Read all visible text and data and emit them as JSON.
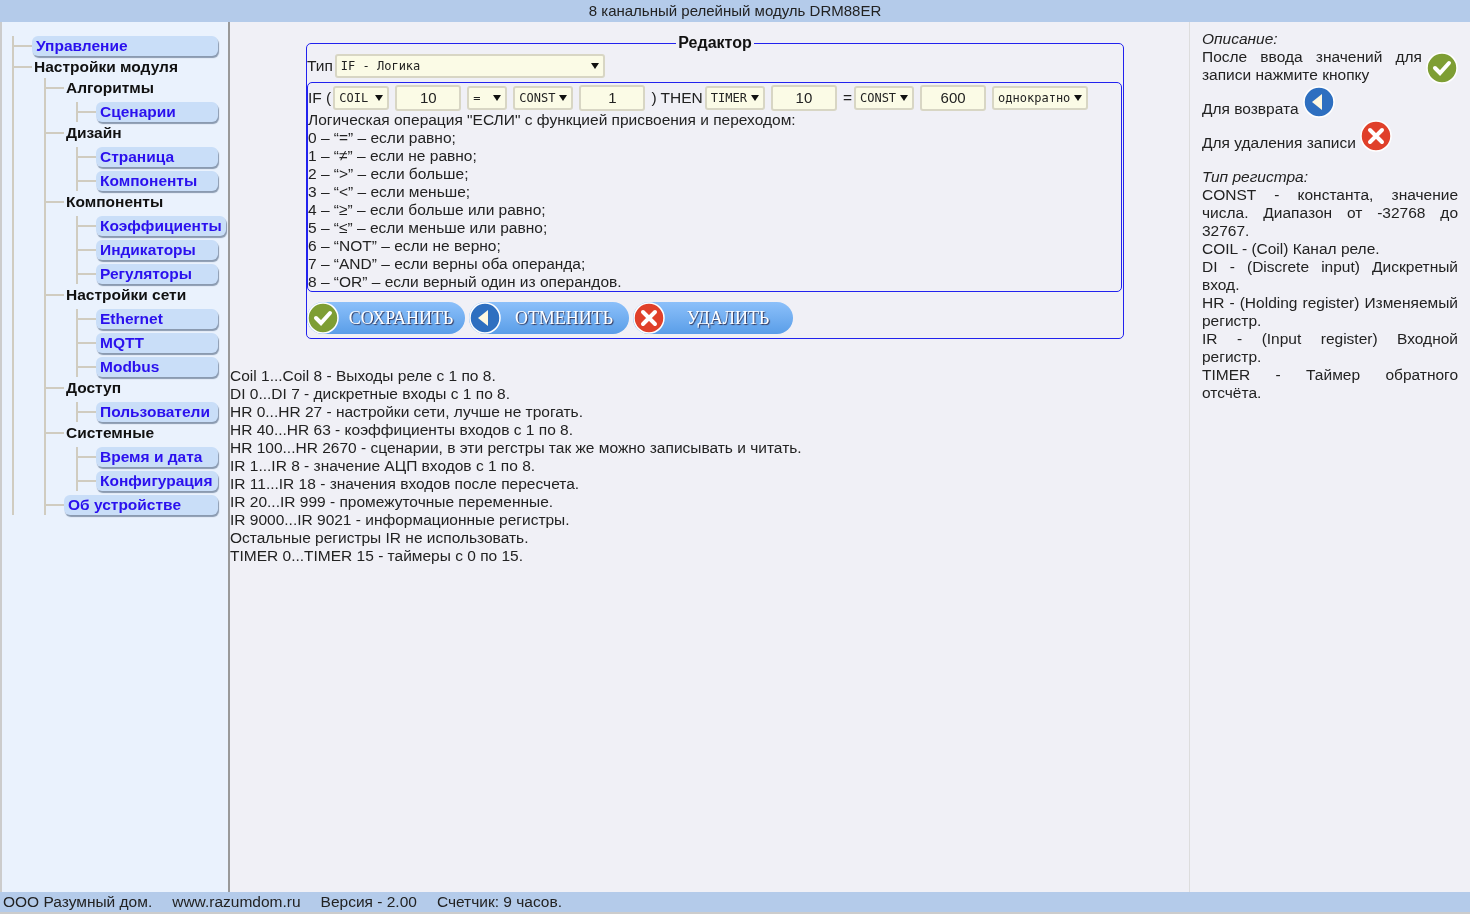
{
  "window": {
    "title": "8 канальный релейный модуль DRM88ER"
  },
  "sidebar": {
    "items": [
      {
        "label": "Управление",
        "kind": "link"
      },
      {
        "label": "Настройки модуля",
        "kind": "heading",
        "children": [
          {
            "label": "Алгоритмы",
            "kind": "heading",
            "children": [
              {
                "label": "Сценарии",
                "kind": "link"
              }
            ]
          },
          {
            "label": "Дизайн",
            "kind": "heading",
            "children": [
              {
                "label": "Страница",
                "kind": "link"
              },
              {
                "label": "Компоненты",
                "kind": "link"
              }
            ]
          },
          {
            "label": "Компоненты",
            "kind": "heading",
            "children": [
              {
                "label": "Коэффициенты",
                "kind": "link"
              },
              {
                "label": "Индикаторы",
                "kind": "link"
              },
              {
                "label": "Регуляторы",
                "kind": "link"
              }
            ]
          },
          {
            "label": "Настройки сети",
            "kind": "heading",
            "children": [
              {
                "label": "Ethernet",
                "kind": "link"
              },
              {
                "label": "MQTT",
                "kind": "link"
              },
              {
                "label": "Modbus",
                "kind": "link"
              }
            ]
          },
          {
            "label": "Доступ",
            "kind": "heading",
            "children": [
              {
                "label": "Пользователи",
                "kind": "link"
              }
            ]
          },
          {
            "label": "Системные",
            "kind": "heading",
            "children": [
              {
                "label": "Время и дата",
                "kind": "link"
              },
              {
                "label": "Конфигурация",
                "kind": "link"
              }
            ]
          },
          {
            "label": "Об устройстве",
            "kind": "link"
          }
        ]
      }
    ]
  },
  "editor": {
    "legend": "Редактор",
    "type_label": "Тип",
    "type_value": "IF  -  Логика",
    "condition": [
      {
        "kind": "text",
        "text": "IF ("
      },
      {
        "kind": "select",
        "value": "COIL"
      },
      {
        "kind": "input",
        "value": "10"
      },
      {
        "kind": "select",
        "value": "="
      },
      {
        "kind": "select",
        "value": "CONST"
      },
      {
        "kind": "input",
        "value": "1"
      },
      {
        "kind": "text",
        "text": ") THEN"
      },
      {
        "kind": "select",
        "value": "TIMER"
      },
      {
        "kind": "input",
        "value": "10"
      },
      {
        "kind": "text",
        "text": "="
      },
      {
        "kind": "select",
        "value": "CONST"
      },
      {
        "kind": "input",
        "value": "600"
      },
      {
        "kind": "select",
        "value": "однократно"
      }
    ],
    "help_lines": [
      "Логическая операция \"ЕСЛИ\" с функцией присвоения и переходом:",
      "0 – “=” – если равно;",
      "1 – “≠” – если не равно;",
      "2 – “>” – если больше;",
      "3 – “<” – если меньше;",
      "4 – “≥” – если больше или равно;",
      "5 – “≤” – если меньше или равно;",
      "6 – “NOT” – если не верно;",
      "7 – “AND” – если верны оба операнда;",
      "8 – “OR” – если верный один из операндов."
    ],
    "buttons": [
      {
        "label": "СОХРАНИТЬ",
        "kind": "save"
      },
      {
        "label": "ОТМЕНИТЬ",
        "kind": "back"
      },
      {
        "label": "УДАЛИТЬ",
        "kind": "delete"
      }
    ]
  },
  "register_notes": [
    "Coil 1...Coil 8 - Выходы реле с 1 по 8.",
    "DI 0...DI 7 - дискретные входы с 1 по 8.",
    "HR 0...HR 27 - настройки сети, лучше не трогать.",
    "HR 40...HR 63 - коэффициенты входов с 1 по 8.",
    "HR 100...HR 2670 - сценарии, в эти регстры так же можно записывать и читать.",
    "IR 1...IR 8 - значение АЦП входов с 1 по 8.",
    "IR 11...IR 18 - значения входов после пересчета.",
    "IR 20...IR 999 - промежуточные переменные.",
    "IR 9000...IR 9021 - информационные регистры.",
    "Остальные регистры IR не использовать.",
    "TIMER 0...TIMER 15 - таймеры с 0 по 15."
  ],
  "help_panel": {
    "description_title": "Описание:",
    "hints": [
      {
        "text": "После ввода значений для записи нажмите кнопку",
        "kind": "save"
      },
      {
        "text": "Для возврата",
        "kind": "back"
      },
      {
        "text": "Для удаления записи",
        "kind": "delete"
      }
    ],
    "types_title": "Тип регистра:",
    "types": [
      "CONST - константа, значение числа. Диапазон от -32768 до 32767.",
      "COIL - (Coil) Канал реле.",
      "DI - (Discrete input) Дискретный вход.",
      "HR - (Holding register) Изменяемый регистр.",
      "IR - (Input register) Входной регистр.",
      "TIMER - Таймер обратного отсчёта."
    ]
  },
  "status_bar": [
    "ООО Разумный дом.",
    "www.razumdom.ru",
    "Версия - 2.00",
    "Счетчик: 9 часов."
  ]
}
